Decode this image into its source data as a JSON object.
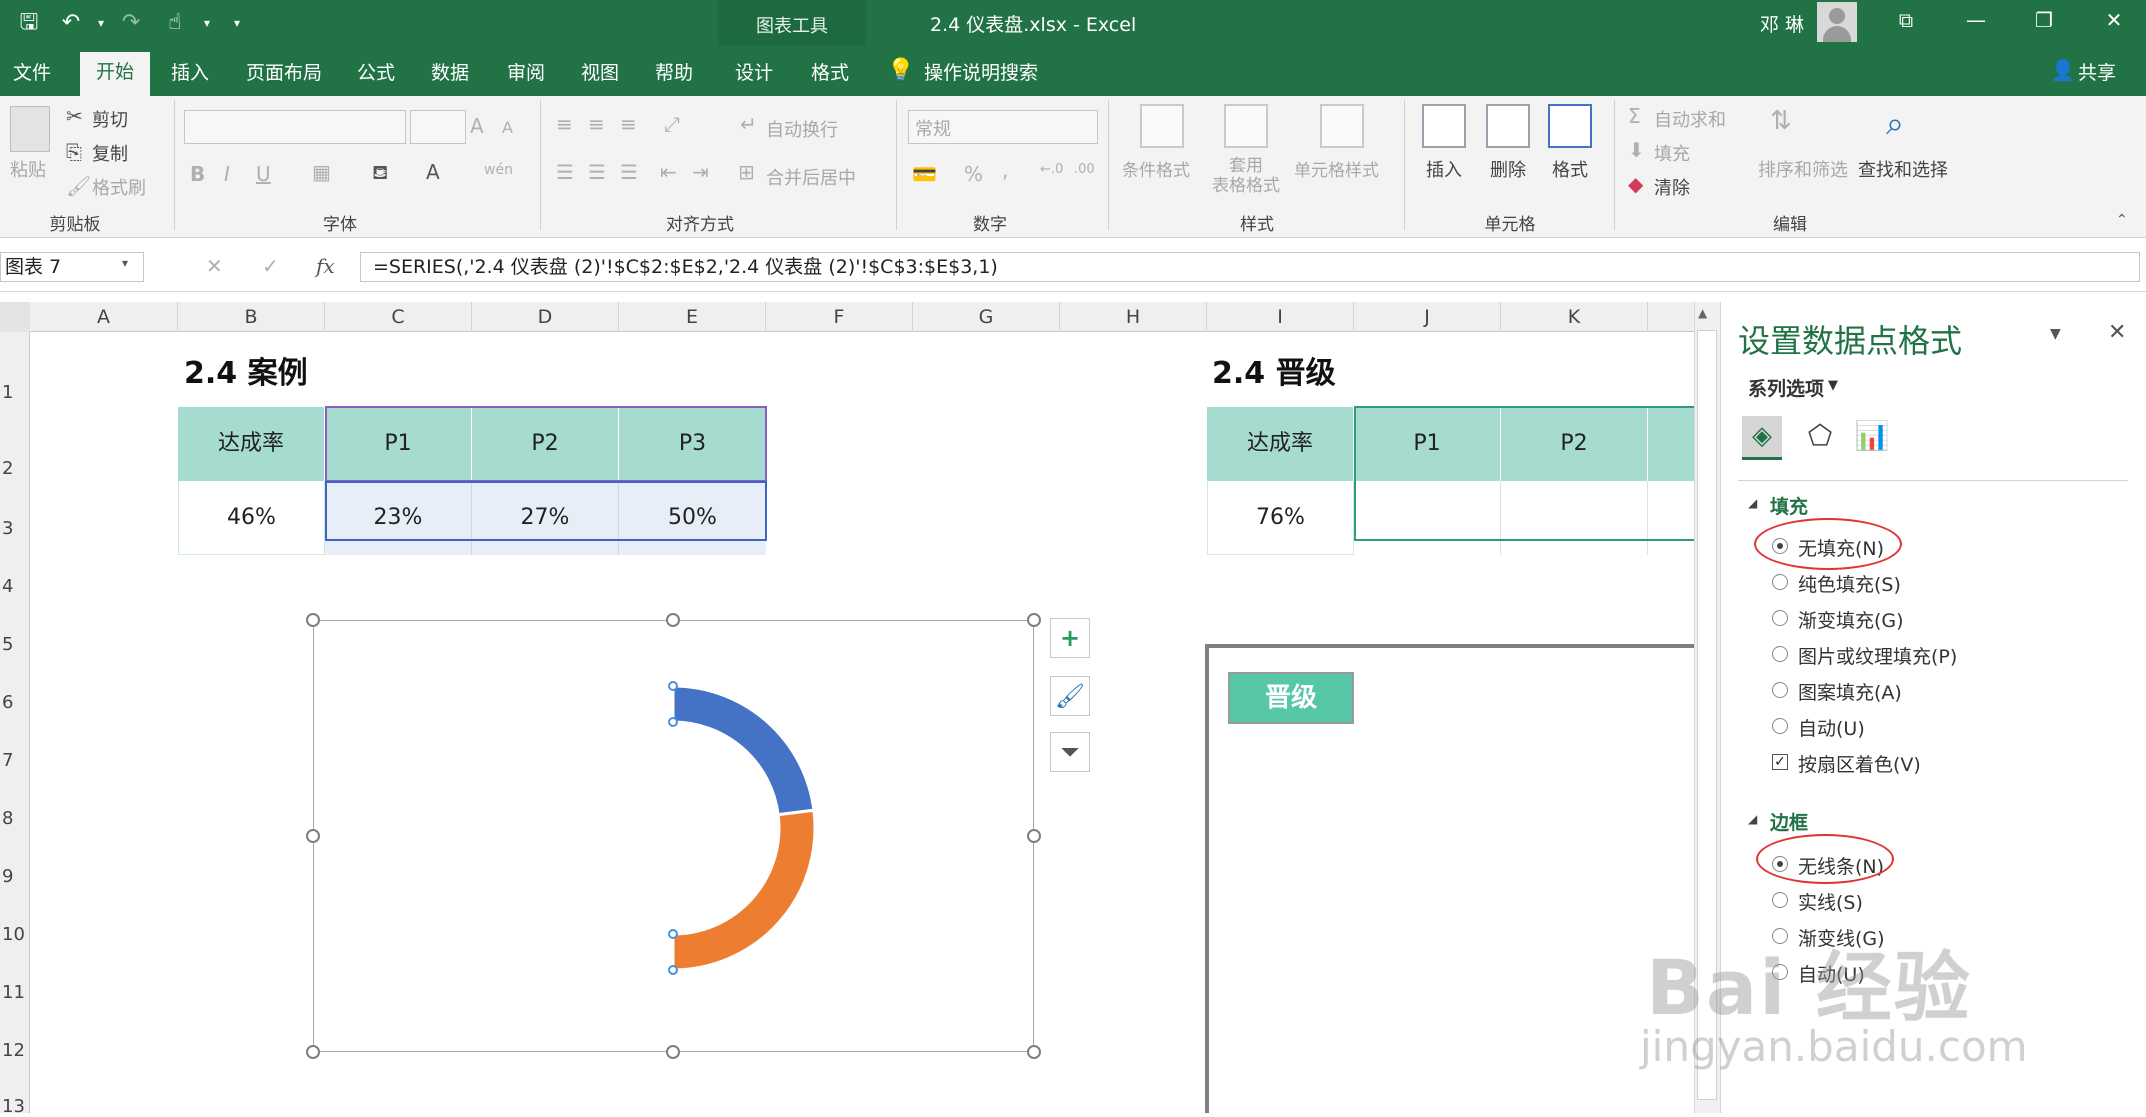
{
  "title_bar": {
    "context_tab": "图表工具",
    "doc_title": "2.4 仪表盘.xlsx  -  Excel",
    "user": "邓 琳"
  },
  "tabs": [
    "文件",
    "开始",
    "插入",
    "页面布局",
    "公式",
    "数据",
    "审阅",
    "视图",
    "帮助",
    "设计",
    "格式"
  ],
  "tell_me": "操作说明搜索",
  "share": "共享",
  "ribbon": {
    "clipboard": {
      "paste": "粘贴",
      "cut": "剪切",
      "copy": "复制",
      "format_painter": "格式刷",
      "label": "剪贴板"
    },
    "font": {
      "label": "字体",
      "bold": "B",
      "italic": "I",
      "underline": "U",
      "grow": "A",
      "shrink": "A",
      "color_a": "A",
      "wen": "wén"
    },
    "alignment": {
      "wrap": "自动换行",
      "merge": "合并后居中",
      "label": "对齐方式"
    },
    "number": {
      "format": "常规",
      "percent": "%",
      "comma": ",",
      "label": "数字"
    },
    "styles": {
      "cond": "条件格式",
      "table": "套用\n表格格式",
      "cell_style": "单元格样式",
      "label": "样式"
    },
    "cells": {
      "insert": "插入",
      "delete": "删除",
      "format": "格式",
      "label": "单元格"
    },
    "editing": {
      "autosum": "自动求和",
      "fill": "填充",
      "clear": "清除",
      "sort": "排序和筛选",
      "find": "查找和选择",
      "label": "编辑"
    }
  },
  "name_box": "图表 7",
  "formula": "=SERIES(,'2.4 仪表盘 (2)'!$C$2:$E$2,'2.4 仪表盘 (2)'!$C$3:$E$3,1)",
  "fx": "fx",
  "columns": [
    "A",
    "B",
    "C",
    "D",
    "E",
    "F",
    "G",
    "H",
    "I",
    "J",
    "K"
  ],
  "rows": [
    "1",
    "2",
    "3",
    "4",
    "5",
    "6",
    "7",
    "8",
    "9",
    "10",
    "11",
    "12",
    "13"
  ],
  "sheet": {
    "case_title": "2.4 案例",
    "case_table": {
      "headers": [
        "达成率",
        "P1",
        "P2",
        "P3"
      ],
      "values": [
        "46%",
        "23%",
        "27%",
        "50%"
      ]
    },
    "adv_title": "2.4 晋级",
    "adv_table": {
      "headers": [
        "达成率",
        "P1",
        "P2"
      ],
      "values": [
        "76%",
        "",
        ""
      ]
    },
    "badge": "晋级"
  },
  "chart_data": {
    "type": "doughnut",
    "categories": [
      "P1",
      "P2",
      "P3"
    ],
    "values": [
      23,
      27,
      50
    ],
    "colors": [
      "#4472c4",
      "#ed7d31",
      "#ffffff"
    ],
    "start_angle_deg": 0,
    "third_slice_fill": "none"
  },
  "chart_buttons": [
    "+",
    "brush",
    "filter"
  ],
  "pane": {
    "title": "设置数据点格式",
    "series_options": "系列选项",
    "fill_section": "填充",
    "fill_options": [
      "无填充(N)",
      "纯色填充(S)",
      "渐变填充(G)",
      "图片或纹理填充(P)",
      "图案填充(A)",
      "自动(U)"
    ],
    "fill_selected": "无填充(N)",
    "vary_colors": "按扇区着色(V)",
    "border_section": "边框",
    "border_options": [
      "无线条(N)",
      "实线(S)",
      "渐变线(G)",
      "自动(U)"
    ],
    "border_selected": "无线条(N)"
  },
  "watermark": {
    "brand": "Bai 经验",
    "url": "jingyan.baidu.com"
  },
  "colors": {
    "excel_green": "#217346",
    "header_teal": "#a6dcd0",
    "selection": "#e8eef8",
    "badge": "#57c7a8"
  }
}
